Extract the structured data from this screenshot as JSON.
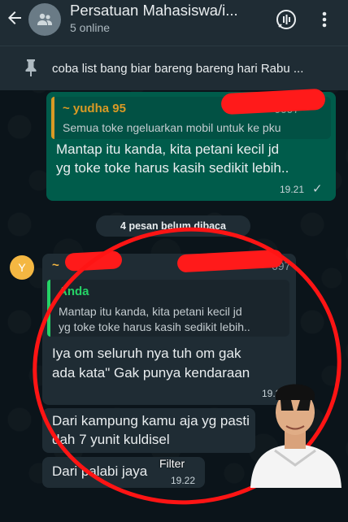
{
  "header": {
    "title": "Persatuan Mahasiswa/i...",
    "subtitle": "5 online"
  },
  "pinned": {
    "text": "coba list bang biar bareng bareng hari Rabu ..."
  },
  "msg1": {
    "quote_name": "~ yudha 95",
    "quote_number_fragment": "6697",
    "quote_text": "Semua toke ngeluarkan mobil untuk ke pku",
    "text_line1": "Mantap itu kanda, kita petani kecil jd",
    "text_line2": "yg toke toke harus kasih sedikit lebih..",
    "time": "19.21",
    "status": "✓"
  },
  "unread_banner": "4 pesan belum dibaca",
  "msg2": {
    "sender_avatar_letter": "Y",
    "sender_prefix": "~",
    "sender_number_fragment": "697",
    "quote_name": "Anda",
    "quote_line1": "Mantap itu kanda, kita petani kecil jd",
    "quote_line2": "yg toke toke harus kasih sedikit lebih..",
    "text_line1": "Iya om seluruh nya tuh om gak",
    "text_line2": "ada kata\" Gak punya kendaraan",
    "time": "19.2"
  },
  "msg3": {
    "text_line1": "Dari kampung kamu aja yg pasti",
    "text_line2": "dah 7 yunit kuldisel"
  },
  "msg4": {
    "text": "Dari palabi jaya",
    "time": "19.22"
  },
  "overlay": {
    "filter_label": "Filter"
  },
  "colors": {
    "outgoing_bubble": "#005c4b",
    "incoming_bubble": "#1f2c34",
    "quote_name_yudha": "#d99a25",
    "quote_name_anda": "#25d366",
    "annotation_red": "#ff1414"
  }
}
